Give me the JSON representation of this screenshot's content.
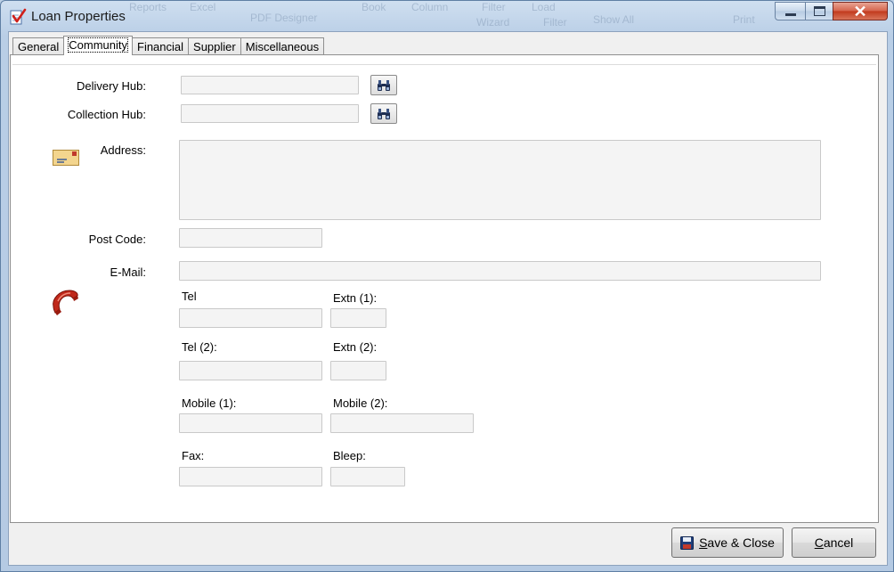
{
  "window": {
    "title": "Loan Properties",
    "background_toolbar_text": [
      "Reports",
      "Excel",
      "PDF Designer",
      "Book",
      "Column",
      "Filter",
      "Load",
      "Wizard",
      "Filter",
      "Show All",
      "Print"
    ]
  },
  "tabs": [
    {
      "label": "General",
      "active": false
    },
    {
      "label": "Community",
      "active": true
    },
    {
      "label": "Financial",
      "active": false
    },
    {
      "label": "Supplier",
      "active": false
    },
    {
      "label": "Miscellaneous",
      "active": false
    }
  ],
  "form": {
    "delivery_hub_label": "Delivery Hub:",
    "delivery_hub_value": "",
    "collection_hub_label": "Collection Hub:",
    "collection_hub_value": "",
    "address_label": "Address:",
    "address_value": "",
    "post_code_label": "Post Code:",
    "post_code_value": "",
    "email_label": "E-Mail:",
    "email_value": "",
    "tel_label": "Tel",
    "tel_value": "",
    "extn1_label": "Extn (1):",
    "extn1_value": "",
    "tel2_label": "Tel (2):",
    "tel2_value": "",
    "extn2_label": "Extn (2):",
    "extn2_value": "",
    "mobile1_label": "Mobile (1):",
    "mobile1_value": "",
    "mobile2_label": "Mobile (2):",
    "mobile2_value": "",
    "fax_label": "Fax:",
    "fax_value": "",
    "bleep_label": "Bleep:",
    "bleep_value": ""
  },
  "buttons": {
    "save_close_mnemonic": "S",
    "save_close_rest": "ave & Close",
    "cancel_mnemonic": "C",
    "cancel_rest": "ancel"
  },
  "icons": {
    "app": "checkmark-document-icon",
    "find": "binoculars-icon",
    "address": "envelope-icon",
    "phone": "telephone-icon",
    "save": "floppy-disk-icon"
  },
  "colors": {
    "field_bg": "#f4f4f4",
    "phone_red": "#c0281a",
    "close_red": "#c1391c"
  }
}
